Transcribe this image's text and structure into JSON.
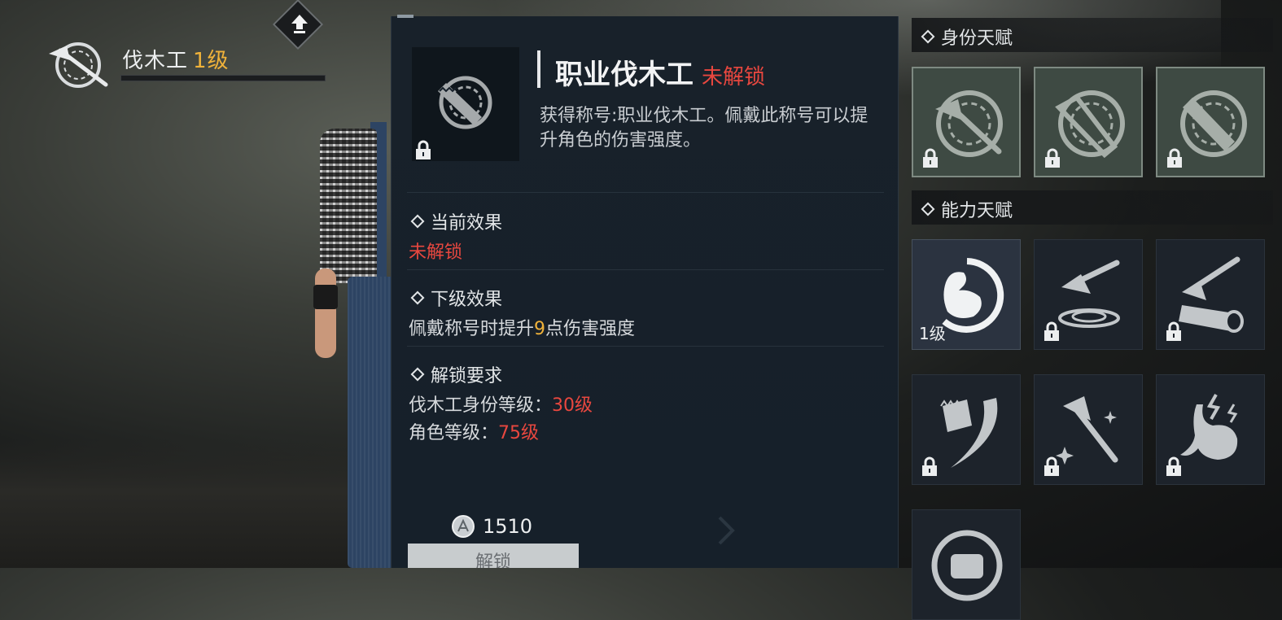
{
  "profession": {
    "name": "伐木工",
    "level": "1级"
  },
  "detail": {
    "title": "职业伐木工",
    "status": "未解锁",
    "description": "获得称号:职业伐木工。佩戴此称号可以提升角色的伤害强度。",
    "current_effect": {
      "heading": "当前效果",
      "value": "未解锁"
    },
    "next_effect": {
      "heading": "下级效果",
      "prefix": "佩戴称号时提升",
      "amount": "9",
      "suffix": "点伤害强度"
    },
    "requirements": {
      "heading": "解锁要求",
      "items": [
        {
          "label": "伐木工身份等级：",
          "value": "30级"
        },
        {
          "label": "角色等级：",
          "value": "75级"
        }
      ]
    },
    "cost": "1510",
    "unlock_button": "解锁"
  },
  "identity_talents": {
    "heading": "身份天赋",
    "slots": [
      {
        "icon": "axe-badge-icon",
        "locked": true
      },
      {
        "icon": "log-badge-icon",
        "locked": true
      },
      {
        "icon": "saw-badge-icon",
        "locked": true
      }
    ]
  },
  "ability_talents": {
    "heading": "能力天赋",
    "slots": [
      {
        "icon": "flexed-arm-icon",
        "locked": false,
        "level": "1级"
      },
      {
        "icon": "axe-in-ground-icon",
        "locked": true
      },
      {
        "icon": "axe-on-log-icon",
        "locked": true
      },
      {
        "icon": "chainsaw-swing-icon",
        "locked": true
      },
      {
        "icon": "sparkling-axe-icon",
        "locked": true
      },
      {
        "icon": "stomach-icon",
        "locked": true
      },
      {
        "icon": "fist-icon",
        "locked": true
      }
    ]
  },
  "colors": {
    "level_gold": "#f0b23a",
    "locked_red": "#e8473f",
    "panel_bg": "#18212a"
  }
}
